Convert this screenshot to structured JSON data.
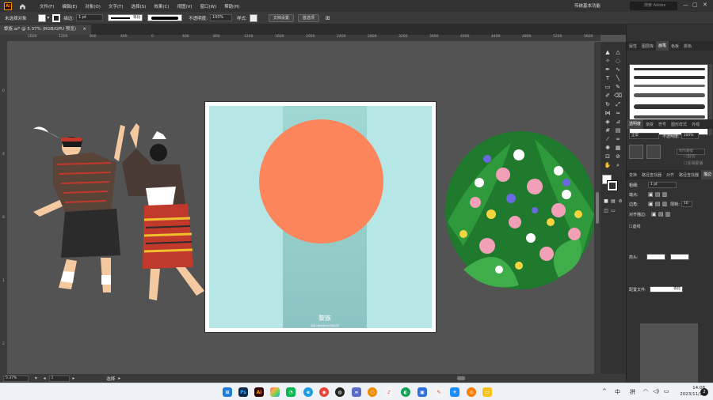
{
  "menubar": {
    "app_logo": "Ai",
    "menus": [
      "文件(F)",
      "编辑(E)",
      "对象(O)",
      "文字(T)",
      "选择(S)",
      "效果(C)",
      "视图(V)",
      "窗口(W)",
      "帮助(H)"
    ],
    "workspace": "传统基本功能",
    "search_placeholder": "搜索 Adobe Stock"
  },
  "controlbar": {
    "selection_label": "未选择对象",
    "stroke_label": "描边:",
    "stroke_weight": "1 pt",
    "stroke_profile": "等比",
    "opacity_label": "不透明度:",
    "opacity_value": "100%",
    "style_label": "样式:",
    "doc_setup_button": "文档设置",
    "preferences_button": "首选项"
  },
  "tab": {
    "title": "黎族.ai* @ 5.37% (RGB/GPU 预览)",
    "close": "×"
  },
  "ruler": {
    "top_ticks": [
      "1600",
      "1200",
      "800",
      "400",
      "0",
      "400",
      "800",
      "1200",
      "1600",
      "2000",
      "2400",
      "2800",
      "3200",
      "3600",
      "4000",
      "4400",
      "4800",
      "5200",
      "5600"
    ],
    "left_ticks": [
      "0",
      "4",
      "8",
      "1",
      "2"
    ]
  },
  "artboard": {
    "title": "黎族",
    "subtitle": "海南少数民族文化传播宣传",
    "colors": {
      "background": "#b6e6e5",
      "strip": "#9fd8d3",
      "sun": "#fd855c"
    }
  },
  "statusbar": {
    "zoom": "5.37%",
    "artboard_num": "1",
    "tool": "选择"
  },
  "panels": {
    "brush_tabs": [
      "属性",
      "图层库",
      "画笔",
      "色板",
      "颜色"
    ],
    "transparency_tabs": [
      "透明度",
      "渐变",
      "符号",
      "图形样式",
      "外观"
    ],
    "blend_mode": "正常",
    "opacity_label": "不透明度:",
    "opacity_value": "100%",
    "make_mask": "制作蒙版",
    "clip": "剪切",
    "invert_mask": "反相蒙版",
    "stroke_tabs": [
      "变换",
      "路径查找器",
      "对齐",
      "路径查找器",
      "描边"
    ],
    "weight_label": "粗细:",
    "weight_value": "1 pt",
    "cap_label": "端点:",
    "corner_label": "边角:",
    "limit_label": "限制:",
    "limit_value": "10",
    "align_label": "对齐描边:",
    "dashed_label": "虚线",
    "arrow_label": "箭头:",
    "profile_label": "配置文件:",
    "profile_value": "等比"
  },
  "taskbar": {
    "tray_text": [
      "中",
      "拼"
    ],
    "time": "14:08",
    "date": "2023/11/15",
    "notifications": "2"
  }
}
